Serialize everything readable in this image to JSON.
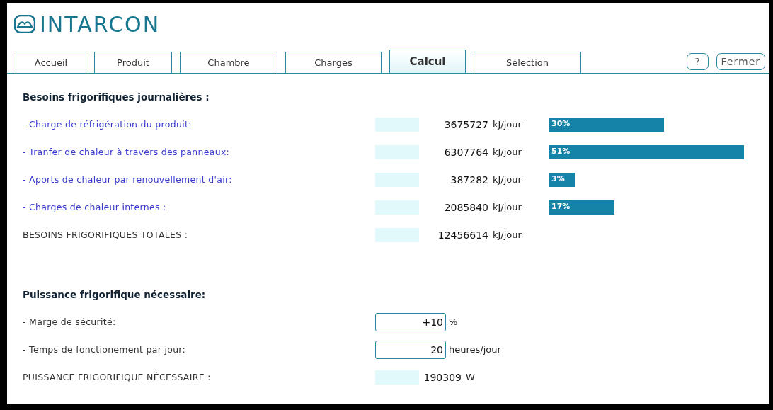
{
  "brand": "INTARCON",
  "tabs": [
    {
      "label": "Accueil",
      "selected": false
    },
    {
      "label": "Produit",
      "selected": false
    },
    {
      "label": "Chambre",
      "selected": false
    },
    {
      "label": "Charges",
      "selected": false
    },
    {
      "label": "Calcul",
      "selected": true
    },
    {
      "label": "Sélection",
      "selected": false
    }
  ],
  "help_button": "?",
  "close_button": "Fermer",
  "daily_needs": {
    "title": "Besoins frigorifiques journalières :",
    "rows": [
      {
        "label": "- Charge de réfrigération du produit:",
        "value": "3675727",
        "unit": "kJ/jour",
        "share": "30%"
      },
      {
        "label": "- Tranfer de chaleur à travers des panneaux:",
        "value": "6307764",
        "unit": "kJ/jour",
        "share": "51%"
      },
      {
        "label": "- Aports de chaleur par renouvellement d'air:",
        "value": "387282",
        "unit": "kJ/jour",
        "share": "3%"
      },
      {
        "label": "- Charges de chaleur internes :",
        "value": "2085840",
        "unit": "kJ/jour",
        "share": "17%"
      }
    ],
    "total": {
      "label": "BESOINS FRIGORIFIQUES TOTALES :",
      "value": "12456614",
      "unit": "kJ/jour"
    }
  },
  "power": {
    "title": "Puissance frigorifique nécessaire:",
    "inputs": [
      {
        "label": "- Marge de sécurité:",
        "value": "+10",
        "unit": "%"
      },
      {
        "label": "- Temps de fonctionement par jour:",
        "value": "20",
        "unit": "heures/jour"
      }
    ],
    "total": {
      "label": "PUISSANCE FRIGORIFIQUE NÉCESSAIRE :",
      "value": "190309",
      "unit": "W"
    }
  }
}
